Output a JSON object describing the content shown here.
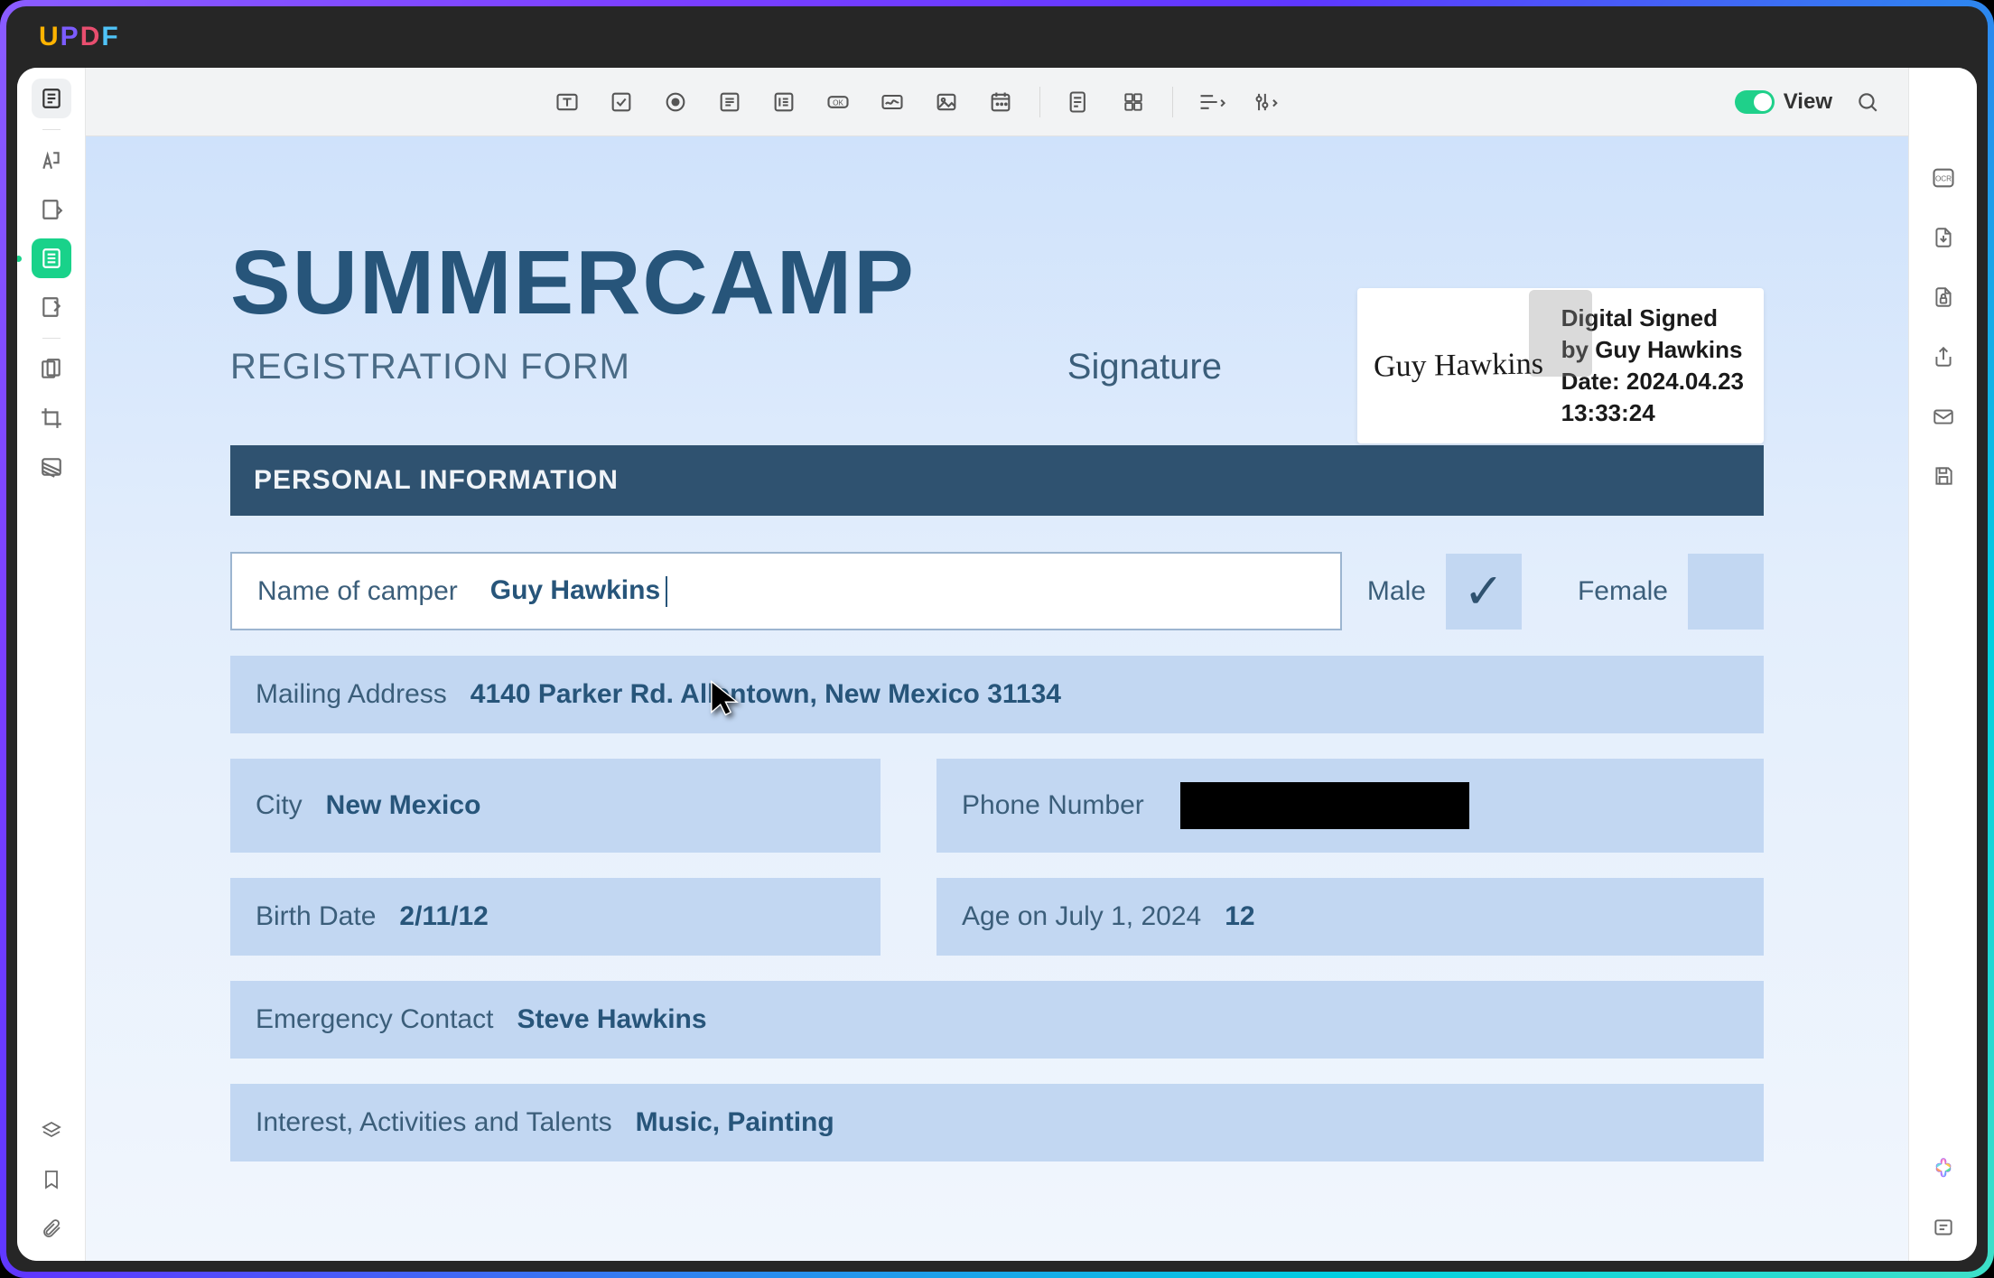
{
  "app": {
    "name_u": "U",
    "name_p": "P",
    "name_d": "D",
    "name_f": "F",
    "view_label": "View"
  },
  "doc": {
    "title": "SUMMERCAMP",
    "subtitle": "REGISTRATION FORM",
    "signature_label": "Signature",
    "signature_name": "Guy Hawkins",
    "signature_meta_1": "Digital Signed",
    "signature_meta_2": "by Guy Hawkins",
    "signature_meta_3": "Date: 2024.04.23",
    "signature_meta_4": "13:33:24",
    "section_personal": "PERSONAL INFORMATION",
    "camper_label": "Name of camper",
    "camper_value": "Guy Hawkins",
    "male_label": "Male",
    "male_checked": true,
    "female_label": "Female",
    "female_checked": false,
    "mailing_label": "Mailing Address",
    "mailing_value": "4140 Parker Rd. Allentown, New Mexico 31134",
    "city_label": "City",
    "city_value": "New Mexico",
    "phone_label": "Phone Number",
    "birth_label": "Birth Date",
    "birth_value": "2/11/12",
    "age_label": "Age on July 1, 2024",
    "age_value": "12",
    "emergency_label": "Emergency Contact",
    "emergency_value": "Steve Hawkins",
    "interests_label": "Interest, Activities and Talents",
    "interests_value": "Music, Painting"
  }
}
